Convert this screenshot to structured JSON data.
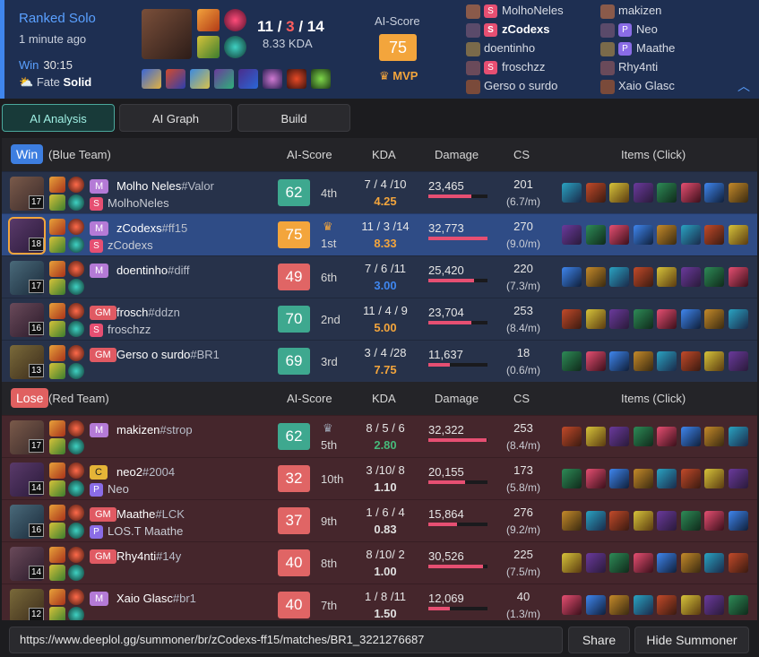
{
  "header": {
    "mode": "Ranked Solo",
    "ago": "1 minute ago",
    "result": "Win",
    "duration": "30:15",
    "fate_label": "Fate",
    "fate_value": "Solid",
    "kills": "11",
    "deaths": "3",
    "assists": "14",
    "kda_ratio": "8.33 KDA",
    "score_label": "AI-Score",
    "score": "75",
    "mvp": "MVP",
    "expand_icon": "chevron-up-icon",
    "blue_players": [
      {
        "name": "MolhoNeles",
        "badge": "S"
      },
      {
        "name": "zCodexs",
        "badge": "S"
      },
      {
        "name": "doentinho",
        "badge": ""
      },
      {
        "name": "froschzz",
        "badge": "S"
      },
      {
        "name": "Gerso o surdo",
        "badge": ""
      }
    ],
    "red_players": [
      {
        "name": "makizen",
        "badge": ""
      },
      {
        "name": "Neo",
        "badge": "P"
      },
      {
        "name": "Maathe",
        "badge": "P"
      },
      {
        "name": "Rhy4nti",
        "badge": ""
      },
      {
        "name": "Xaio Glasc",
        "badge": ""
      }
    ]
  },
  "tabs": [
    {
      "label": "AI Analysis"
    },
    {
      "label": "AI Graph"
    },
    {
      "label": "Build"
    }
  ],
  "columns": {
    "score": "AI-Score",
    "kda": "KDA",
    "damage": "Damage",
    "cs": "CS",
    "items": "Items (Click)"
  },
  "teams": [
    {
      "result": "Win",
      "name": "(Blue Team)",
      "players": [
        {
          "level": "17",
          "tier": "M",
          "name": "Molho Neles",
          "tag": "#Valor",
          "sub_badge": "S",
          "sub": "MolhoNeles",
          "score": "62",
          "rank": "4th",
          "kda": "7 / 4 /10",
          "ratio": "4.25",
          "damage": "23,465",
          "damage_frac": 0.72,
          "cs": "201",
          "csm": "(6.7/m)"
        },
        {
          "level": "18",
          "tier": "M",
          "name": "zCodexs",
          "tag": "#ff15",
          "sub_badge": "S",
          "sub": "zCodexs",
          "score": "75",
          "rank": "1st",
          "kda": "11 / 3 /14",
          "ratio": "8.33",
          "damage": "32,773",
          "damage_frac": 1.0,
          "cs": "270",
          "csm": "(9.0/m)"
        },
        {
          "level": "17",
          "tier": "M",
          "name": "doentinho",
          "tag": "#diff",
          "sub_badge": "",
          "sub": "",
          "score": "49",
          "rank": "6th",
          "kda": "7 / 6 /11",
          "ratio": "3.00",
          "damage": "25,420",
          "damage_frac": 0.78,
          "cs": "220",
          "csm": "(7.3/m)"
        },
        {
          "level": "16",
          "tier": "GM",
          "name": "frosch",
          "tag": "#ddzn",
          "sub_badge": "S",
          "sub": "froschzz",
          "score": "70",
          "rank": "2nd",
          "kda": "11 / 4 / 9",
          "ratio": "5.00",
          "damage": "23,704",
          "damage_frac": 0.72,
          "cs": "253",
          "csm": "(8.4/m)"
        },
        {
          "level": "13",
          "tier": "GM",
          "name": "Gerso o surdo",
          "tag": "#BR1",
          "sub_badge": "",
          "sub": "",
          "score": "69",
          "rank": "3rd",
          "kda": "3 / 4 /28",
          "ratio": "7.75",
          "damage": "11,637",
          "damage_frac": 0.36,
          "cs": "18",
          "csm": "(0.6/m)"
        }
      ]
    },
    {
      "result": "Lose",
      "name": "(Red Team)",
      "players": [
        {
          "level": "17",
          "tier": "M",
          "name": "makizen",
          "tag": "#strop",
          "sub_badge": "",
          "sub": "",
          "score": "62",
          "rank": "5th",
          "kda": "8 / 5 / 6",
          "ratio": "2.80",
          "damage": "32,322",
          "damage_frac": 0.99,
          "cs": "253",
          "csm": "(8.4/m)"
        },
        {
          "level": "14",
          "tier": "C",
          "name": "neo2",
          "tag": "#2004",
          "sub_badge": "P",
          "sub": "Neo",
          "score": "32",
          "rank": "10th",
          "kda": "3 /10/ 8",
          "ratio": "1.10",
          "damage": "20,155",
          "damage_frac": 0.62,
          "cs": "173",
          "csm": "(5.8/m)"
        },
        {
          "level": "16",
          "tier": "GM",
          "name": "Maathe",
          "tag": "#LCK",
          "sub_badge": "P",
          "sub": "LOS.T Maathe",
          "score": "37",
          "rank": "9th",
          "kda": "1 / 6 / 4",
          "ratio": "0.83",
          "damage": "15,864",
          "damage_frac": 0.48,
          "cs": "276",
          "csm": "(9.2/m)"
        },
        {
          "level": "14",
          "tier": "GM",
          "name": "Rhy4nti",
          "tag": "#14y",
          "sub_badge": "",
          "sub": "",
          "score": "40",
          "rank": "8th",
          "kda": "8 /10/ 2",
          "ratio": "1.00",
          "damage": "30,526",
          "damage_frac": 0.93,
          "cs": "225",
          "csm": "(7.5/m)"
        },
        {
          "level": "12",
          "tier": "M",
          "name": "Xaio Glasc",
          "tag": "#br1",
          "sub_badge": "",
          "sub": "",
          "score": "40",
          "rank": "7th",
          "kda": "1 / 8 /11",
          "ratio": "1.50",
          "damage": "12,069",
          "damage_frac": 0.37,
          "cs": "40",
          "csm": "(1.3/m)"
        }
      ]
    }
  ],
  "footer": {
    "url": "https://www.deeplol.gg/summoner/br/zCodexs-ff15/matches/BR1_3221276687",
    "share": "Share",
    "hide": "Hide Summoner"
  },
  "colors": {
    "score_high": "#3ea88f",
    "score_mvp": "#f3a53c",
    "score_low": "#e06565",
    "ratio_high": "#f3a53c",
    "ratio_mid": "#3f86ee",
    "ratio_green": "#46b97a",
    "ratio_plain": "#e0e0e0"
  }
}
